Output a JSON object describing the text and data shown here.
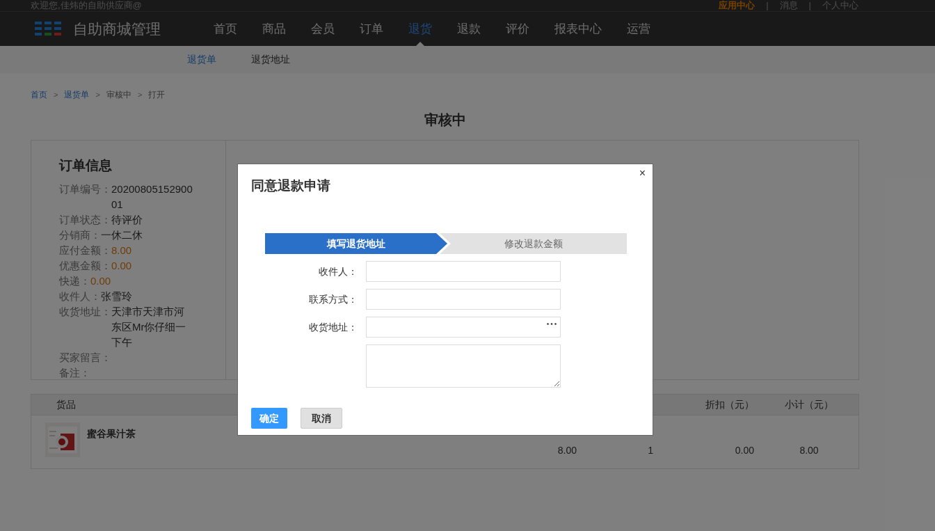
{
  "top_bar": {
    "welcome": "欢迎您,佳炜的自助供应商@",
    "links": [
      {
        "label": "应用中心",
        "highlight": true
      },
      {
        "label": "消息",
        "highlight": false
      },
      {
        "label": "个人中心",
        "highlight": false
      }
    ],
    "separator": "|"
  },
  "header": {
    "logo_text": "自助商城管理",
    "nav": [
      {
        "label": "首页",
        "selected": false
      },
      {
        "label": "商品",
        "selected": false
      },
      {
        "label": "会员",
        "selected": false
      },
      {
        "label": "订单",
        "selected": false
      },
      {
        "label": "退货",
        "selected": true
      },
      {
        "label": "退款",
        "selected": false
      },
      {
        "label": "评价",
        "selected": false
      },
      {
        "label": "报表中心",
        "selected": false
      },
      {
        "label": "运营",
        "selected": false
      }
    ]
  },
  "subnav": [
    {
      "label": "退货单",
      "selected": true
    },
    {
      "label": "退货地址",
      "selected": false
    }
  ],
  "breadcrumb": {
    "separator": ">",
    "items": [
      {
        "label": "首页",
        "kind": "link"
      },
      {
        "label": "退货单",
        "kind": "link"
      },
      {
        "label": "审核中",
        "kind": "text"
      },
      {
        "label": "打开",
        "kind": "text"
      }
    ]
  },
  "page_title": "审核中",
  "order_info": {
    "title": "订单信息",
    "fields": [
      {
        "label": "订单编号：",
        "value": "2020080515290001",
        "kind": "text"
      },
      {
        "label": "订单状态：",
        "value": "待评价",
        "kind": "text"
      },
      {
        "label": "分销商：",
        "value": "一休二休",
        "kind": "text"
      },
      {
        "label": "应付金额：",
        "value": "8.00",
        "kind": "money"
      },
      {
        "label": "优惠金额：",
        "value": "0.00",
        "kind": "money"
      },
      {
        "label": "快递：",
        "value": "0.00",
        "kind": "money"
      },
      {
        "label": "收件人：",
        "value": "张雪玲",
        "kind": "text"
      },
      {
        "label": "收货地址：",
        "value": "天津市天津市河东区Mr你仔细一下午",
        "kind": "text"
      },
      {
        "label": "买家留言："
      },
      {
        "label": "备注："
      }
    ]
  },
  "product_table": {
    "columns": [
      {
        "label": "货品",
        "kind": "product"
      },
      {
        "label": "折扣（元）",
        "kind": "discount"
      },
      {
        "label": "小计（元）",
        "kind": "subtotal"
      }
    ],
    "rows": [
      {
        "name": "蜜谷果汁茶",
        "values": [
          "8.00",
          "1",
          "0.00",
          "8.00"
        ]
      }
    ]
  },
  "dialog": {
    "title": "同意退款申请",
    "close": "×",
    "steps": [
      {
        "label": "填写退货地址",
        "selected": true
      },
      {
        "label": "修改退款金额",
        "selected": false
      }
    ],
    "fields": [
      {
        "label": "收件人：",
        "kind": "input"
      },
      {
        "label": "联系方式：",
        "kind": "input"
      },
      {
        "label": "收货地址：",
        "kind": "picker"
      },
      {
        "kind": "textarea"
      }
    ],
    "buttons": [
      {
        "label": "确定",
        "kind": "primary"
      },
      {
        "label": "取消",
        "kind": "secondary"
      }
    ]
  }
}
